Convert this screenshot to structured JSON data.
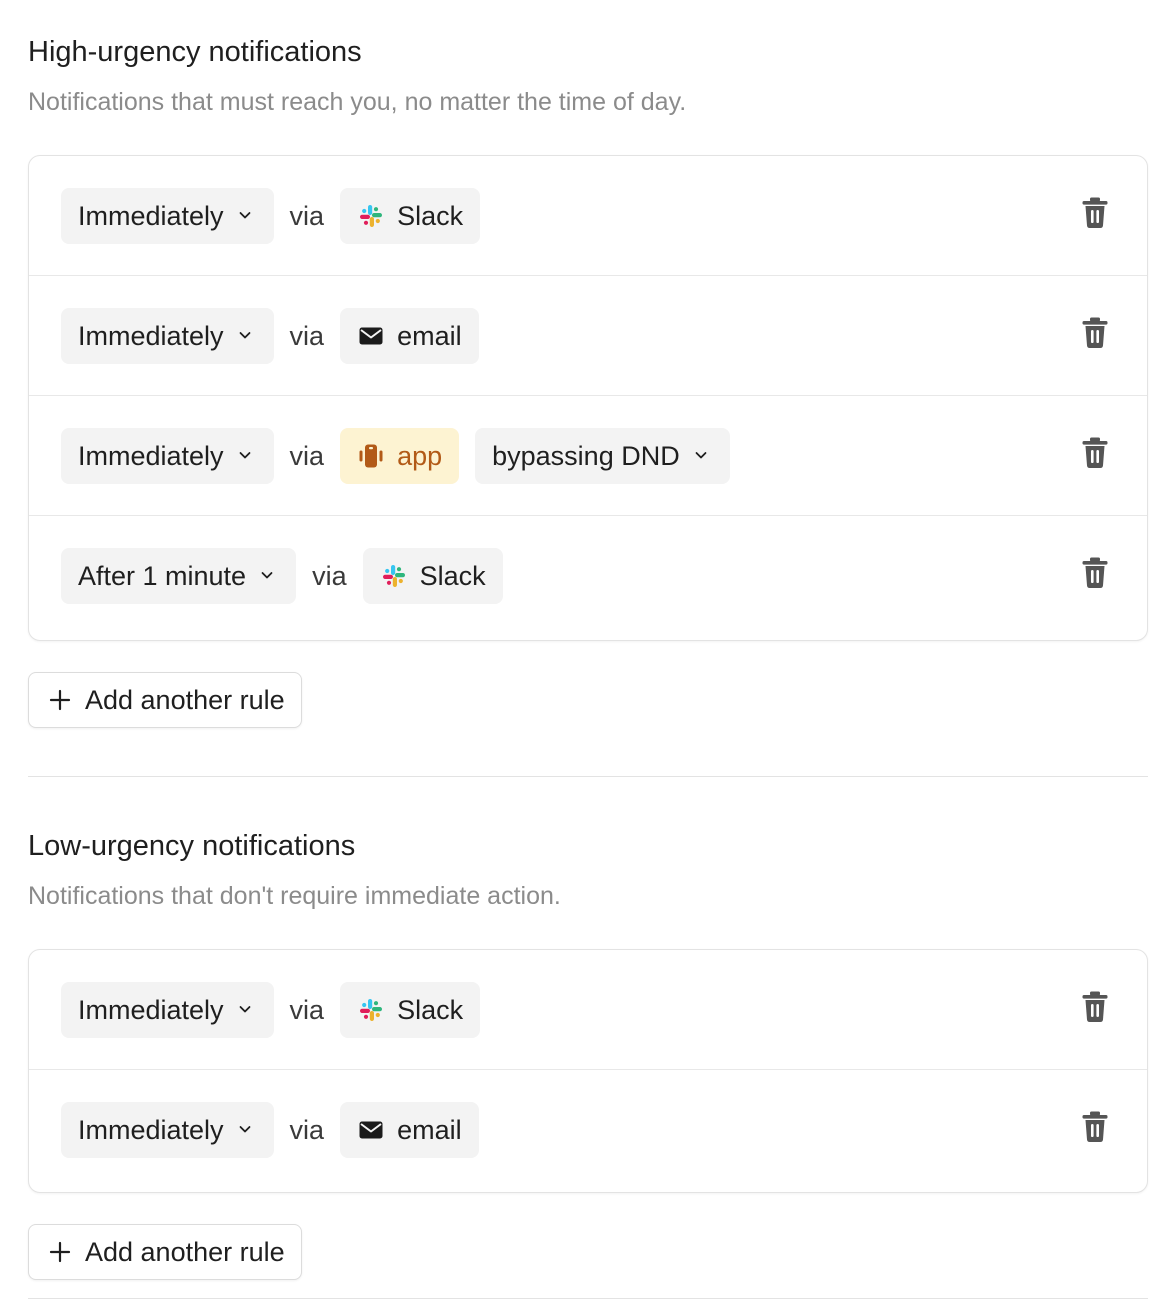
{
  "high": {
    "title": "High-urgency notifications",
    "subtitle": "Notifications that must reach you, no matter the time of day.",
    "rules": [
      {
        "timing": "Immediately",
        "via": "via",
        "channel": "Slack",
        "channel_icon": "slack-icon"
      },
      {
        "timing": "Immediately",
        "via": "via",
        "channel": "email",
        "channel_icon": "envelope-icon"
      },
      {
        "timing": "Immediately",
        "via": "via",
        "channel": "app",
        "channel_icon": "phone-vibrate-icon",
        "modifier": "bypassing DND"
      },
      {
        "timing": "After 1 minute",
        "via": "via",
        "channel": "Slack",
        "channel_icon": "slack-icon"
      }
    ],
    "add_label": "Add another rule"
  },
  "low": {
    "title": "Low-urgency notifications",
    "subtitle": "Notifications that don't require immediate action.",
    "rules": [
      {
        "timing": "Immediately",
        "via": "via",
        "channel": "Slack",
        "channel_icon": "slack-icon"
      },
      {
        "timing": "Immediately",
        "via": "via",
        "channel": "email",
        "channel_icon": "envelope-icon"
      }
    ],
    "add_label": "Add another rule"
  },
  "colors": {
    "pill_bg": "#f3f3f3",
    "app_pill_bg": "#fdf3d2",
    "app_pill_text": "#b25a17",
    "subtitle_text": "#8b8b8b",
    "border": "#e3e3e3"
  }
}
